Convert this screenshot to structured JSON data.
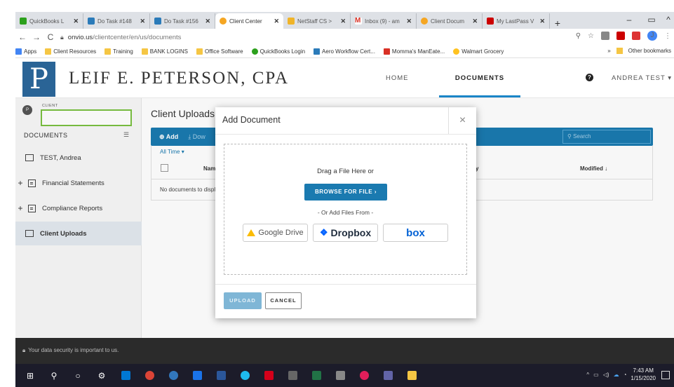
{
  "browser": {
    "tabs": [
      {
        "label": "QuickBooks L",
        "color": "#2ca01c"
      },
      {
        "label": "Do Task #148",
        "color": "#2b7bb9"
      },
      {
        "label": "Do Task #156",
        "color": "#2b7bb9"
      },
      {
        "label": "Client Center",
        "color": "#f5a623"
      },
      {
        "label": "NetStaff CS >",
        "color": "#f0b429"
      },
      {
        "label": "Inbox (9) - am",
        "color": "#d93025"
      },
      {
        "label": "Client Docum",
        "color": "#f5a623"
      },
      {
        "label": "My LastPass V",
        "color": "#cc0000"
      }
    ],
    "new_tab": "+",
    "url_host": "onvio.us",
    "url_path": "/clientcenter/en/us/documents"
  },
  "bookmarks": {
    "items": [
      {
        "label": "Apps",
        "icon": "apps-grid-icon"
      },
      {
        "label": "Client Resources",
        "icon": "folder-icon"
      },
      {
        "label": "Training",
        "icon": "folder-icon"
      },
      {
        "label": "BANK LOGINS",
        "icon": "folder-icon"
      },
      {
        "label": "Office Software",
        "icon": "folder-icon"
      },
      {
        "label": "QuickBooks Login",
        "icon": "quickbooks-icon"
      },
      {
        "label": "Aero Workflow Cert...",
        "icon": "aero-icon"
      },
      {
        "label": "Momma's ManEate...",
        "icon": "momma-icon"
      },
      {
        "label": "Walmart Grocery",
        "icon": "walmart-icon"
      }
    ],
    "more": "»",
    "other": "Other bookmarks"
  },
  "header": {
    "logo_letter": "P",
    "firm_name": "LEIF E. PETERSON, CPA",
    "nav_home": "HOME",
    "nav_documents": "DOCUMENTS",
    "help": "?",
    "user": "ANDREA TEST ▾"
  },
  "sidebar": {
    "avatar": "P",
    "client_label": "CLIENT",
    "docs_heading": "DOCUMENTS",
    "items": [
      {
        "label": "TEST, Andrea"
      },
      {
        "label": "Financial Statements"
      },
      {
        "label": "Compliance Reports"
      },
      {
        "label": "Client Uploads"
      }
    ]
  },
  "main": {
    "title": "Client Uploads",
    "add": "Add",
    "download": "Dow",
    "search_placeholder": "Search",
    "filter": "All Time",
    "col_name": "Name",
    "col_by": "y",
    "col_modified": "Modified ↓",
    "empty": "No documents to display"
  },
  "footer": {
    "security": "Your data security is important to us."
  },
  "taskbar": {
    "time": "7:43 AM",
    "date": "1/15/2020"
  },
  "modal": {
    "title": "Add Document",
    "close": "×",
    "drag_text": "Drag a File Here or",
    "browse": "BROWSE FOR FILE",
    "or_text": "- Or Add Files From -",
    "google_drive": "Google Drive",
    "dropbox": "Dropbox",
    "box": "box",
    "upload": "UPLOAD",
    "cancel": "CANCEL"
  }
}
